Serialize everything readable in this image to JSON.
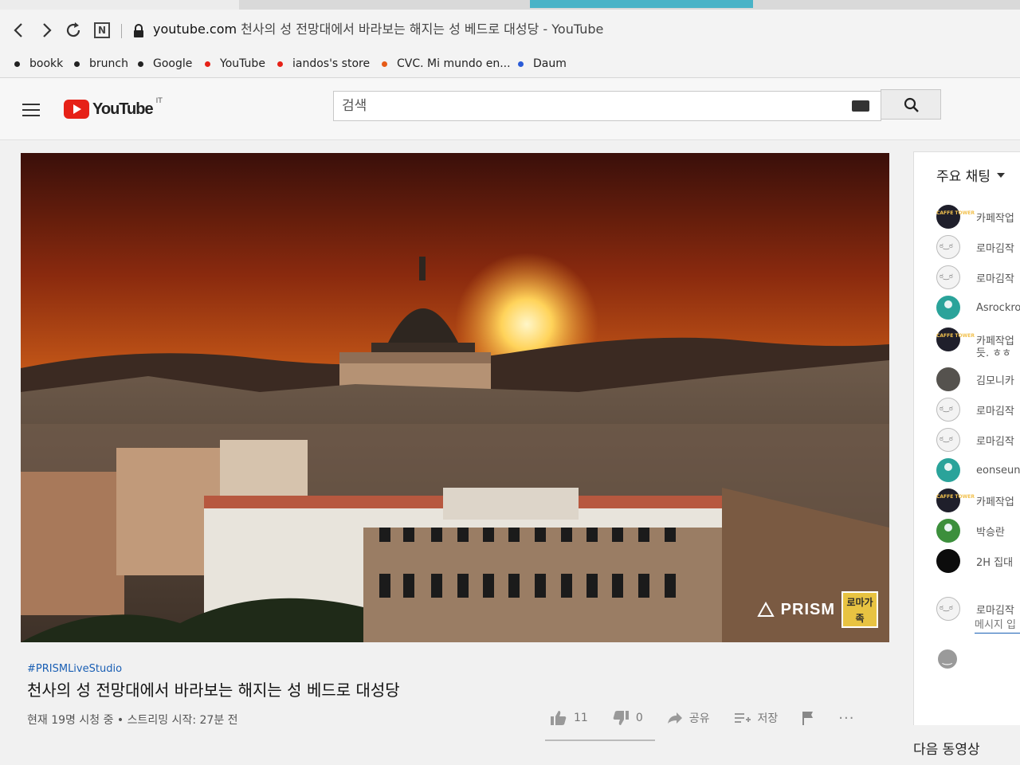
{
  "browser": {
    "url_host": "youtube.com",
    "url_rest": " 천사의 성 전망대에서 바라보는 해지는 성 베드로 대성당 - YouTube",
    "extension_label": "N"
  },
  "bookmarks": [
    {
      "label": "bookk",
      "dot_color": "#222222"
    },
    {
      "label": "brunch",
      "dot_color": "#222222"
    },
    {
      "label": "Google",
      "dot_color": "#222222"
    },
    {
      "label": "YouTube",
      "dot_color": "#e62117"
    },
    {
      "label": "iandos's store",
      "dot_color": "#e62117"
    },
    {
      "label": "CVC. Mi mundo en...",
      "dot_color": "#e65b17"
    },
    {
      "label": "Daum",
      "dot_color": "#2a5bd7"
    }
  ],
  "yt_header": {
    "logo_word": "YouTube",
    "country_code": "IT",
    "search_placeholder": "검색"
  },
  "video": {
    "watermark_text": "PRISM",
    "badge_text": "로마가족"
  },
  "info": {
    "hashtag": "#PRISMLiveStudio",
    "title": "천사의 성 전망대에서 바라보는 해지는 성 베드로 대성당",
    "meta": "현재 19명 시청 중 • 스트리밍 시작: 27분 전",
    "like_count": "11",
    "dislike_count": "0",
    "share_label": "공유",
    "save_label": "저장",
    "more_label": "···"
  },
  "chat": {
    "header": "주요 채팅",
    "messages": [
      {
        "avatar": "cafe",
        "text": "카페작업"
      },
      {
        "avatar": "smile",
        "text": "로마김작"
      },
      {
        "avatar": "smile",
        "text": "로마김작"
      },
      {
        "avatar": "person-teal",
        "text": "Asrockro"
      },
      {
        "avatar": "cafe",
        "text": "카페작업"
      },
      {
        "avatar": "photo",
        "text": "김모니카"
      },
      {
        "avatar": "smile",
        "text": "로마김작"
      },
      {
        "avatar": "smile",
        "text": "로마김작"
      },
      {
        "avatar": "person-teal",
        "text": "eonseun"
      },
      {
        "avatar": "cafe",
        "text": "카페작업"
      },
      {
        "avatar": "person-green",
        "text": "박승란"
      },
      {
        "avatar": "dark",
        "text": "2H 집대"
      }
    ],
    "message_5_continuation": "듯. ㅎㅎ",
    "input_author": "로마김작",
    "input_placeholder": "메시지 입",
    "cafe_avatar_text": "CAFFE TOWER"
  },
  "up_next": "다음 동영상"
}
